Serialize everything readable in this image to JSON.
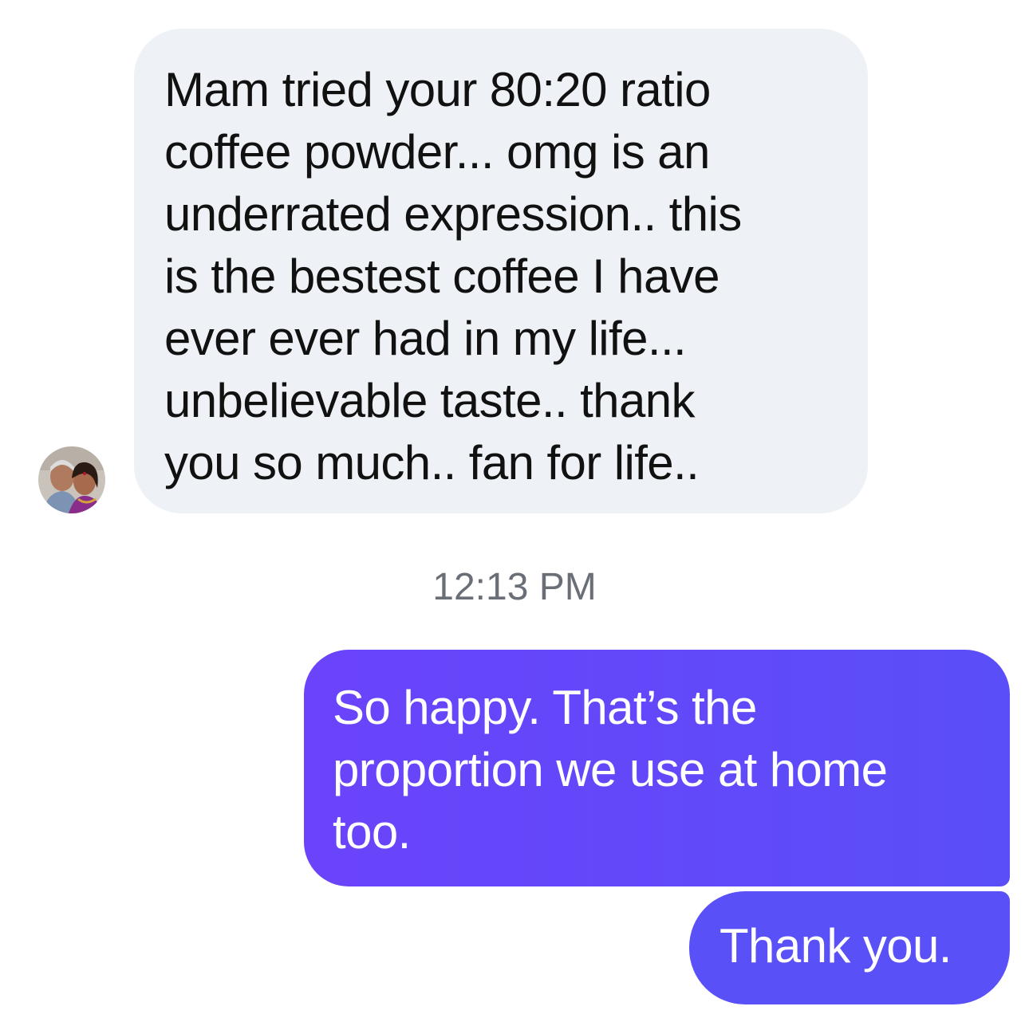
{
  "incoming_message": {
    "lines": [
      "Mam tried your 80:20 ratio",
      "coffee powder... omg is an",
      "underrated expression.. this",
      "is the bestest coffee I have",
      "ever ever had in my life...",
      "unbelievable taste.. thank",
      "you so much.. fan for life.."
    ],
    "avatar_icon": "profile-photo-avatar"
  },
  "timestamp": "12:13 PM",
  "outgoing_messages": [
    {
      "lines": [
        "So happy. That’s the",
        "proportion we use at home",
        "too."
      ]
    },
    {
      "text": "Thank you."
    }
  ],
  "colors": {
    "incoming_bubble": "#eef1f5",
    "outgoing_bubble_start": "#6a43fb",
    "outgoing_bubble_end": "#5a4ef8",
    "timestamp_text": "#6a6f77"
  }
}
